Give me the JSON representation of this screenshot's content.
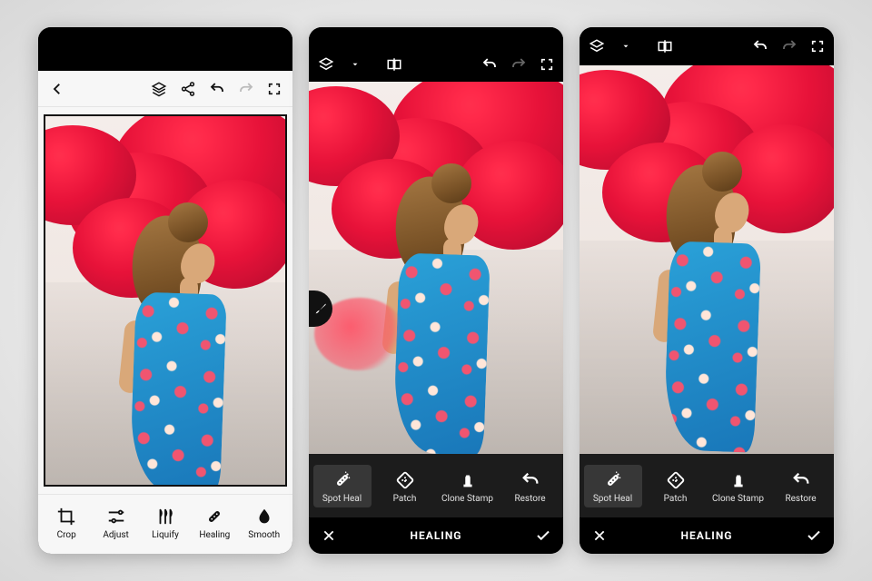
{
  "phone1": {
    "toolbar_icons": {
      "back": "back-chevron",
      "layers": "layers-icon",
      "share": "share-icon",
      "undo": "undo-icon",
      "redo": "redo-icon",
      "fullscreen": "fullscreen-icon"
    },
    "tools": [
      {
        "id": "crop",
        "label": "Crop"
      },
      {
        "id": "adjust",
        "label": "Adjust"
      },
      {
        "id": "liquify",
        "label": "Liquify"
      },
      {
        "id": "healing",
        "label": "Healing"
      },
      {
        "id": "smooth",
        "label": "Smooth"
      }
    ]
  },
  "phone2": {
    "toolbar_icons": {
      "layers": "layers-icon",
      "compare": "compare-icon",
      "undo": "undo-icon",
      "redo": "redo-icon",
      "fullscreen": "fullscreen-icon"
    },
    "brush_indicator": "brush-icon",
    "healing_tools": [
      {
        "id": "spot",
        "label": "Spot Heal",
        "selected": true
      },
      {
        "id": "patch",
        "label": "Patch",
        "selected": false
      },
      {
        "id": "clone",
        "label": "Clone Stamp",
        "selected": false
      },
      {
        "id": "restore",
        "label": "Restore",
        "selected": false
      }
    ],
    "footer": {
      "cancel": "✕",
      "title": "HEALING",
      "accept": "✓"
    },
    "paint_overlay": true
  },
  "phone3": {
    "toolbar_icons": {
      "layers": "layers-icon",
      "compare": "compare-icon",
      "undo": "undo-icon",
      "redo": "redo-icon",
      "fullscreen": "fullscreen-icon"
    },
    "healing_tools": [
      {
        "id": "spot",
        "label": "Spot Heal",
        "selected": true
      },
      {
        "id": "patch",
        "label": "Patch",
        "selected": false
      },
      {
        "id": "clone",
        "label": "Clone Stamp",
        "selected": false
      },
      {
        "id": "restore",
        "label": "Restore",
        "selected": false
      }
    ],
    "footer": {
      "cancel": "✕",
      "title": "HEALING",
      "accept": "✓"
    },
    "paint_overlay": false
  }
}
